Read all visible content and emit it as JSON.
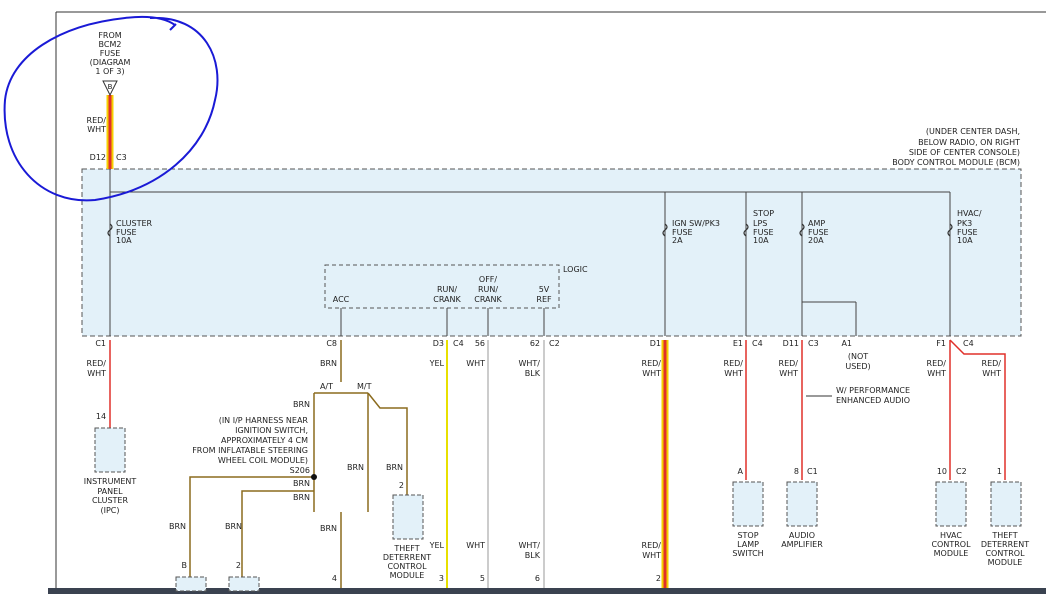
{
  "source": {
    "from": "FROM",
    "bcm2": "BCM2",
    "fuse": "FUSE",
    "diagram": "(DIAGRAM",
    "diagram_page": "1 OF 3)",
    "connector_letter": "B",
    "wire_color": "RED/",
    "wire_color2": "WHT",
    "pin": "D12",
    "conn": "C3"
  },
  "module": {
    "location1": "(UNDER CENTER DASH,",
    "location2": "BELOW RADIO, ON RIGHT",
    "location3": "SIDE OF CENTER CONSOLE)",
    "name": "BODY CONTROL MODULE (BCM)"
  },
  "fuses": {
    "cluster": [
      "CLUSTER",
      "FUSE",
      "10A"
    ],
    "ign": [
      "IGN SW/PK3",
      "FUSE",
      "2A"
    ],
    "stop": [
      "STOP",
      "LPS",
      "FUSE",
      "10A"
    ],
    "amp": [
      "AMP",
      "FUSE",
      "20A"
    ],
    "hvac": [
      "HVAC/",
      "PK3",
      "FUSE",
      "10A"
    ]
  },
  "logic": {
    "title": "LOGIC",
    "acc": "ACC",
    "run1": "RUN/",
    "run2": "CRANK",
    "off1": "OFF/",
    "off2": "RUN/",
    "off3": "CRANK",
    "ref1": "5V",
    "ref2": "REF"
  },
  "pins": {
    "c1": "C1",
    "c8": "C8",
    "d3": "D3",
    "c4a": "C4",
    "p56": "56",
    "p62": "62",
    "c2": "C2",
    "d1": "D1",
    "e1": "E1",
    "c4b": "C4",
    "d11": "D11",
    "c3": "C3",
    "a1": "A1",
    "f1": "F1",
    "c4c": "C4"
  },
  "wires": {
    "redwht1": "RED/",
    "redwht2": "WHT",
    "brn": "BRN",
    "yel": "YEL",
    "wht": "WHT",
    "whtblk1": "WHT/",
    "whtblk2": "BLK",
    "at": "A/T",
    "mt": "M/T",
    "not_used1": "(NOT",
    "not_used2": "USED)",
    "perf1": "W/ PERFORMANCE",
    "perf2": "ENHANCED AUDIO"
  },
  "splice": {
    "note1": "(IN I/P HARNESS NEAR",
    "note2": "IGNITION SWITCH,",
    "note3": "APPROXIMATELY 4 CM",
    "note4": "FROM INFLATABLE STEERING",
    "note5": "WHEEL COIL MODULE)",
    "id": "S206"
  },
  "components": {
    "ipc": {
      "pin": "14",
      "lines": [
        "INSTRUMENT",
        "PANEL",
        "CLUSTER",
        "(IPC)"
      ]
    },
    "theft1": {
      "pin": "2",
      "lines": [
        "THEFT",
        "DETERRENT",
        "CONTROL",
        "MODULE"
      ]
    },
    "stop_sw": {
      "pin": "A",
      "lines": [
        "STOP",
        "LAMP",
        "SWITCH"
      ]
    },
    "amp": {
      "pin": "8",
      "conn": "C1",
      "lines": [
        "AUDIO",
        "AMPLIFIER"
      ]
    },
    "hvac": {
      "pin": "10",
      "conn": "C2",
      "lines": [
        "HVAC",
        "CONTROL",
        "MODULE"
      ]
    },
    "theft2": {
      "pin": "1",
      "lines": [
        "THEFT",
        "DETERRENT",
        "CONTROL",
        "MODULE"
      ]
    }
  },
  "bottom_pins": {
    "b": "B",
    "p2": "2",
    "p4": "4",
    "p3": "3",
    "p5": "5",
    "p6": "6",
    "p2b": "2"
  },
  "colors": {
    "brn": "#8b6b1e",
    "yel": "#e8e000",
    "wht": "#bbbbbb",
    "red": "#e0302a",
    "highlight": "#f5d000",
    "bcm_fill": "#e3f1f9",
    "annotation": "#1a1ad6"
  }
}
